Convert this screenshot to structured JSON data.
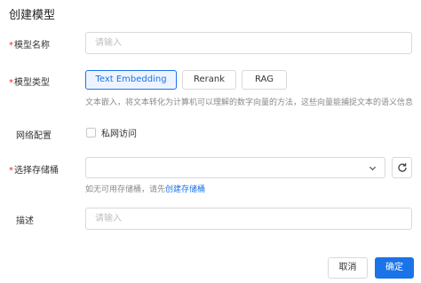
{
  "dialog": {
    "title": "创建模型"
  },
  "form": {
    "model_name": {
      "label": "模型名称",
      "placeholder": "请输入"
    },
    "model_type": {
      "label": "模型类型",
      "options": [
        "Text Embedding",
        "Rerank",
        "RAG"
      ],
      "selected": "Text Embedding",
      "help": "文本嵌入，将文本转化为计算机可以理解的数字向量的方法，这些向量能捕捉文本的语义信息"
    },
    "network": {
      "label": "网络配置",
      "checkbox_label": "私网访问",
      "checked": false
    },
    "bucket": {
      "label": "选择存储桶",
      "value": "",
      "help_prefix": "如无可用存储桶，请先",
      "help_link": "创建存储桶"
    },
    "description": {
      "label": "描述",
      "placeholder": "请输入"
    }
  },
  "footer": {
    "cancel_label": "取消",
    "confirm_label": "确定"
  },
  "colors": {
    "primary": "#1a73e8",
    "required": "#f5222d"
  }
}
